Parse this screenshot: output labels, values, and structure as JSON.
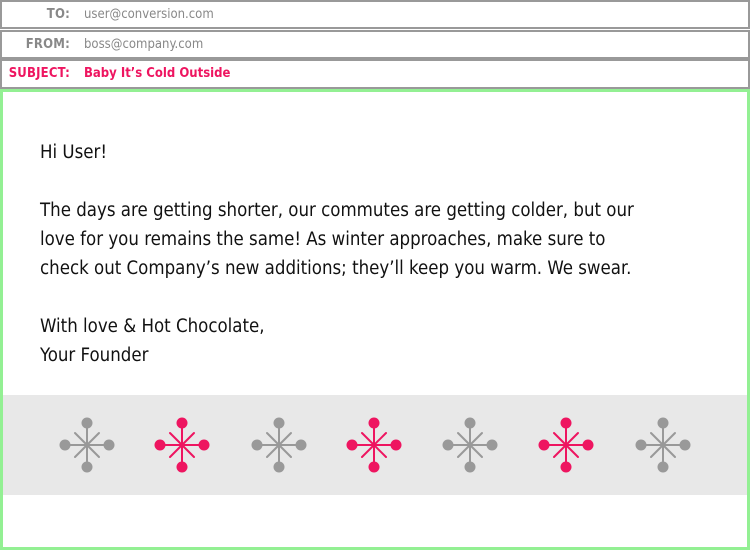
{
  "header": {
    "to_label": "TO:",
    "to_value": "user@conversion.com",
    "from_label": "FROM:",
    "from_value": "boss@company.com",
    "subject_label": "SUBJECT:",
    "subject_value": "Baby It’s Cold Outside"
  },
  "message": {
    "greeting": "Hi User!",
    "paragraph_lines": [
      "The days are getting shorter, our commutes are getting colder, but our",
      "love for you remains the same!  As winter approaches, make sure to",
      "check out Company’s new additions; they’ll keep you warm.  We swear."
    ],
    "signoff": "With love & Hot Chocolate,",
    "signature": "Your Founder"
  },
  "decoration": {
    "icon": "snowflake-icon",
    "pattern": [
      "gray",
      "pink",
      "gray",
      "pink",
      "gray",
      "pink",
      "gray"
    ],
    "colors": {
      "gray": "#999999",
      "pink": "#ee1560",
      "band": "#e8e8e8",
      "frame": "#93f093"
    }
  }
}
